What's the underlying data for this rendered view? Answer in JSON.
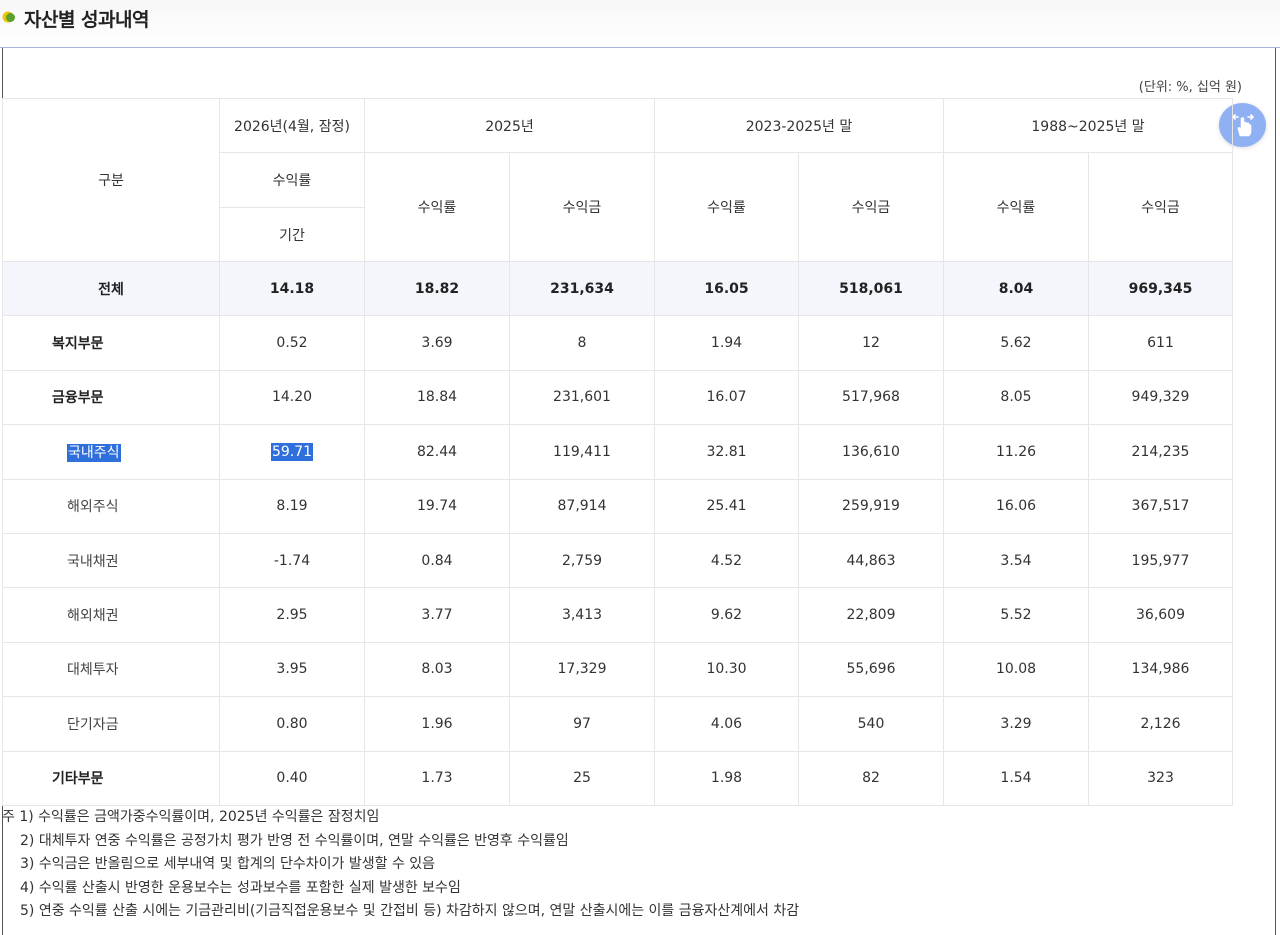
{
  "header": {
    "title": "자산별 성과내역"
  },
  "unit_label": "(단위: %, 십억 원)",
  "table": {
    "col_group_label": "구분",
    "periods": [
      "2026년(4월, 잠정)",
      "2025년",
      "2023-2025년 말",
      "1988~2025년 말"
    ],
    "sub_labels": {
      "rate": "수익률",
      "amount": "수익금",
      "period": "기간"
    },
    "rows": [
      {
        "label": "전체",
        "values": [
          "14.18",
          "18.82",
          "231,634",
          "16.05",
          "518,061",
          "8.04",
          "969,345"
        ]
      },
      {
        "label": "복지부문",
        "values": [
          "0.52",
          "3.69",
          "8",
          "1.94",
          "12",
          "5.62",
          "611"
        ]
      },
      {
        "label": "금융부문",
        "values": [
          "14.20",
          "18.84",
          "231,601",
          "16.07",
          "517,968",
          "8.05",
          "949,329"
        ]
      },
      {
        "label": "국내주식",
        "values": [
          "59.71",
          "82.44",
          "119,411",
          "32.81",
          "136,610",
          "11.26",
          "214,235"
        ]
      },
      {
        "label": "해외주식",
        "values": [
          "8.19",
          "19.74",
          "87,914",
          "25.41",
          "259,919",
          "16.06",
          "367,517"
        ]
      },
      {
        "label": "국내채권",
        "values": [
          "-1.74",
          "0.84",
          "2,759",
          "4.52",
          "44,863",
          "3.54",
          "195,977"
        ]
      },
      {
        "label": "해외채권",
        "values": [
          "2.95",
          "3.77",
          "3,413",
          "9.62",
          "22,809",
          "5.52",
          "36,609"
        ]
      },
      {
        "label": "대체투자",
        "values": [
          "3.95",
          "8.03",
          "17,329",
          "10.30",
          "55,696",
          "10.08",
          "134,986"
        ]
      },
      {
        "label": "단기자금",
        "values": [
          "0.80",
          "1.96",
          "97",
          "4.06",
          "540",
          "3.29",
          "2,126"
        ]
      },
      {
        "label": "기타부문",
        "values": [
          "0.40",
          "1.73",
          "25",
          "1.98",
          "82",
          "1.54",
          "323"
        ]
      }
    ]
  },
  "notes": [
    "주 1) 수익률은 금액가중수익률이며, 2025년 수익률은 잠정치임",
    "2) 대체투자 연중 수익률은 공정가치 평가 반영 전 수익률이며, 연말 수익률은 반영후 수익률임",
    "3) 수익금은 반올림으로 세부내역 및 합계의 단수차이가 발생할 수 있음",
    "4) 수익률 산출시 반영한 운용보수는 성과보수를 포함한 실제 발생한 보수임",
    "5) 연중 수익률 산출 시에는 기금관리비(기금직접운용보수 및 간접비 등) 차감하지 않으며, 연말 산출시에는 이를 금융자산계에서 차감"
  ],
  "colors": {
    "accent": "#8fb0f3",
    "highlight": "#2f6fdc",
    "header_rule": "#a8b4d8",
    "total_row_bg": "#f4f6fb"
  },
  "icons": {
    "title_bullet": "yellow-green-bullet-icon",
    "float_button": "swipe-hand-icon"
  }
}
